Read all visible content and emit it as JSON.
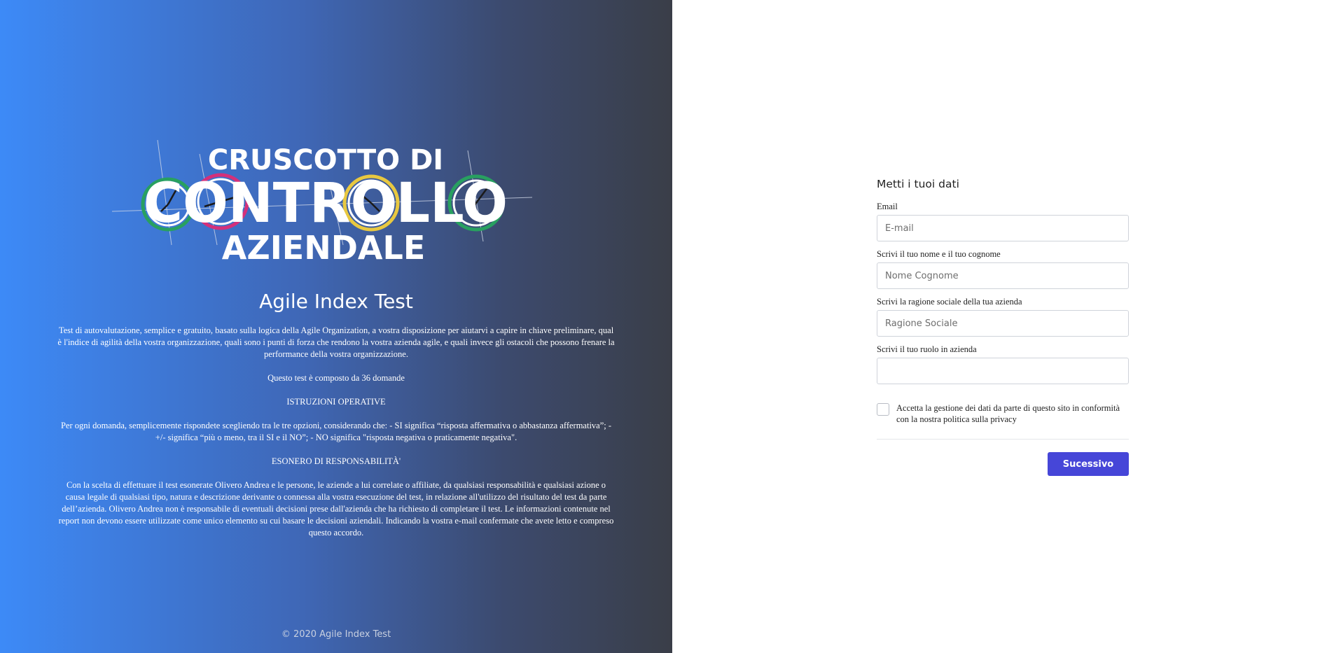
{
  "colors": {
    "gradient_start": "#3d8af7",
    "gradient_end": "#3a3e48",
    "button_bg": "#4646d8",
    "logo_ring_green": "#28a060",
    "logo_ring_magenta": "#d4307a",
    "logo_ring_yellow": "#e8c840"
  },
  "logo": {
    "line1": "CRUSCOTTO DI",
    "line2": "CONTROLLO",
    "line3": "AZIENDALE"
  },
  "intro": {
    "title": "Agile Index Test",
    "description": "Test di autovalutazione, semplice e gratuito, basato sulla logica della Agile Organization, a vostra disposizione per aiutarvi a capire in chiave preliminare, qual è l'indice di agilità della vostra organizzazione, quali sono i punti di forza che rendono la vostra azienda agile, e quali invece gli ostacoli che possono frenare la performance della vostra organizzazione.",
    "question_count": "Questo test è composto da 36 domande",
    "instructions_heading": "ISTRUZIONI OPERATIVE",
    "instructions_text": "Per ogni domanda, semplicemente rispondete scegliendo tra le tre opzioni, considerando che: - SI significa “risposta affermativa o abbastanza affermativa”; - +/- significa “più o meno, tra il SI e il NO”; - NO significa \"risposta negativa o praticamente negativa\".",
    "disclaimer_heading": "ESONERO DI RESPONSABILITÀ'",
    "disclaimer_text": "Con la scelta di effettuare il test esonerate Olivero Andrea e le persone, le aziende a lui correlate o affiliate, da qualsiasi responsabilità e qualsiasi azione o causa legale di qualsiasi tipo, natura e descrizione derivante o connessa alla vostra esecuzione del test, in relazione all'utilizzo del risultato del test da parte dell’azienda. Olivero Andrea non è responsabile di eventuali decisioni prese dall'azienda che ha richiesto di completare il test. Le informazioni contenute nel report non devono essere utilizzate come unico elemento su cui basare le decisioni aziendali. Indicando la vostra e-mail confermate che avete letto e compreso questo accordo.",
    "footer": "© 2020 Agile Index Test"
  },
  "form": {
    "title": "Metti i tuoi dati",
    "email": {
      "label": "Email",
      "placeholder": "E-mail",
      "value": ""
    },
    "name": {
      "label": "Scrivi il tuo nome e il tuo cognome",
      "placeholder": "Nome Cognome",
      "value": ""
    },
    "company": {
      "label": "Scrivi la ragione sociale della tua azienda",
      "placeholder": "Ragione Sociale",
      "value": ""
    },
    "role": {
      "label": "Scrivi il tuo ruolo in azienda",
      "placeholder": "",
      "value": ""
    },
    "privacy_label": "Accetta la gestione dei dati da parte di questo sito in conformità con la nostra politica sulla privacy",
    "privacy_checked": false,
    "next_button": "Sucessivo"
  }
}
